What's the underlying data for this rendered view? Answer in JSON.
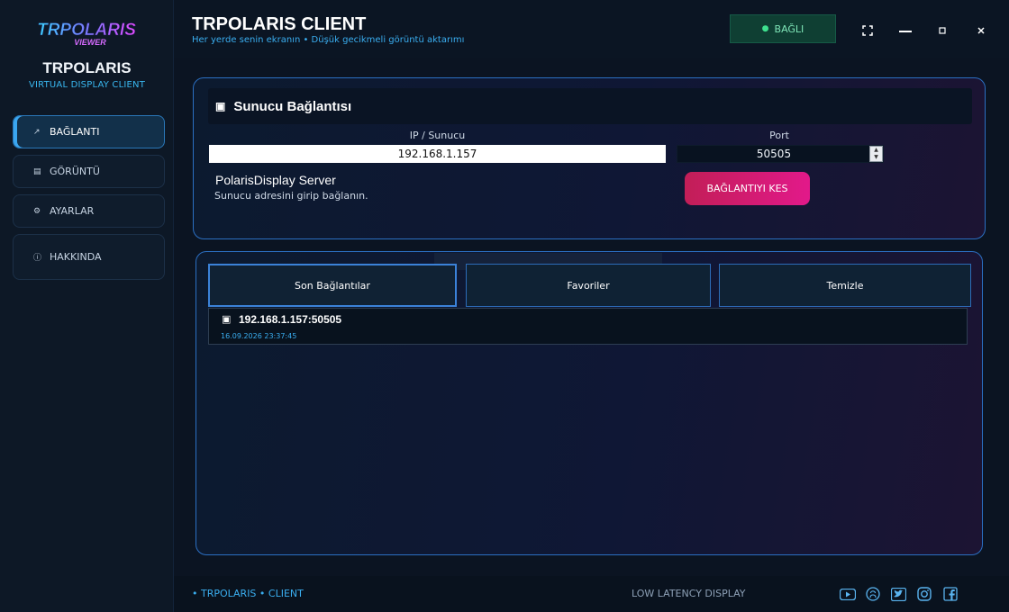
{
  "sidebar": {
    "logo_text": "TRPOLARIS",
    "logo_sub": "VIEWER",
    "brand": "TRPOLARIS",
    "brand_sub": "VIRTUAL DISPLAY CLIENT",
    "items": [
      {
        "icon": "arrow-icon",
        "label": "BAĞLANTI",
        "active": true
      },
      {
        "icon": "monitor-icon",
        "label": "GÖRÜNTÜ"
      },
      {
        "icon": "gear-icon",
        "label": "AYARLAR"
      },
      {
        "icon": "info-icon",
        "label": "HAKKINDA"
      }
    ]
  },
  "header": {
    "title": "TRPOLARIS CLIENT",
    "subtitle": "Her yerde senin ekranın  •  Düşük gecikmeli görüntü aktarımı",
    "status": "BAĞLI"
  },
  "connection": {
    "heading": "Sunucu Bağlantısı",
    "ip_label": "IP / Sunucu",
    "ip_value": "192.168.1.157",
    "port_label": "Port",
    "port_value": "50505",
    "server_name": "PolarisDisplay Server",
    "server_hint": "Sunucu adresini girip bağlanın.",
    "disconnect_label": "BAĞLANTIYI KES"
  },
  "history": {
    "tabs": [
      "Son Bağlantılar",
      "Favoriler",
      "Temizle"
    ],
    "active_tab": 0,
    "records": [
      {
        "address": "192.168.1.157:50505",
        "time": "16.09.2026 23:37:45"
      }
    ]
  },
  "footer": {
    "left": "• TRPOLARIS  •  CLIENT",
    "center": "LOW LATENCY DISPLAY",
    "social_icons": [
      "youtube-icon",
      "github-icon",
      "twitter-icon",
      "instagram-icon",
      "facebook-icon"
    ]
  },
  "colors": {
    "accent": "#3aaef0",
    "status_bg": "#0f3f33",
    "danger_gradient_start": "#c21e57",
    "danger_gradient_end": "#e2198a"
  }
}
